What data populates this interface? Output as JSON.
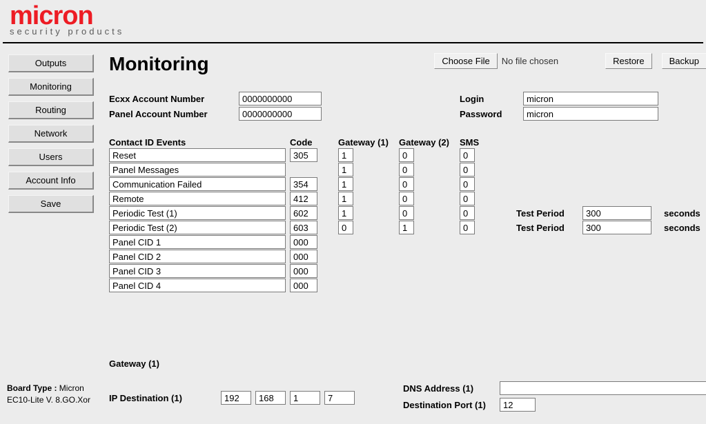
{
  "brand": {
    "name": "micron",
    "tagline": "security products"
  },
  "nav": [
    "Outputs",
    "Monitoring",
    "Routing",
    "Network",
    "Users",
    "Account Info",
    "Save"
  ],
  "board": {
    "type_label": "Board Type :",
    "type_value": "Micron",
    "version": "EC10-Lite V. 8.GO.Xor"
  },
  "page": {
    "title": "Monitoring"
  },
  "toolbar": {
    "choose_file": "Choose File",
    "no_file": "No file chosen",
    "restore": "Restore",
    "backup": "Backup"
  },
  "account": {
    "ecxx_label": "Ecxx Account Number",
    "ecxx_value": "0000000000",
    "panel_label": "Panel Account Number",
    "panel_value": "0000000000",
    "login_label": "Login",
    "login_value": "micron",
    "password_label": "Password",
    "password_value": "micron"
  },
  "events_header": {
    "events": "Contact ID Events",
    "code": "Code",
    "gw1": "Gateway  (1)",
    "gw2": "Gateway  (2)",
    "sms": "SMS"
  },
  "events": [
    {
      "name": "Reset",
      "code": "305",
      "gw1": "1",
      "gw2": "0",
      "sms": "0"
    },
    {
      "name": "Panel Messages",
      "code": "",
      "gw1": "1",
      "gw2": "0",
      "sms": "0"
    },
    {
      "name": "Communication Failed",
      "code": "354",
      "gw1": "1",
      "gw2": "0",
      "sms": "0"
    },
    {
      "name": "Remote",
      "code": "412",
      "gw1": "1",
      "gw2": "0",
      "sms": "0"
    },
    {
      "name": "Periodic Test (1)",
      "code": "602",
      "gw1": "1",
      "gw2": "0",
      "sms": "0",
      "extra_label": "Test Period",
      "extra_value": "300",
      "extra_unit": "seconds"
    },
    {
      "name": "Periodic Test (2)",
      "code": "603",
      "gw1": "0",
      "gw2": "1",
      "sms": "0",
      "extra_label": "Test Period",
      "extra_value": "300",
      "extra_unit": "seconds"
    },
    {
      "name": "Panel CID 1",
      "code": "000"
    },
    {
      "name": "Panel CID 2",
      "code": "000"
    },
    {
      "name": "Panel CID 3",
      "code": "000"
    },
    {
      "name": "Panel CID 4",
      "code": "000"
    }
  ],
  "gateway": {
    "heading": "Gateway  (1)",
    "ip_label": "IP Destination  (1)",
    "ip": [
      "192",
      "168",
      "1",
      "7"
    ],
    "dns_label": "DNS Address (1)",
    "dns_value": "",
    "port_label": "Destination Port (1)",
    "port_value": "12"
  }
}
